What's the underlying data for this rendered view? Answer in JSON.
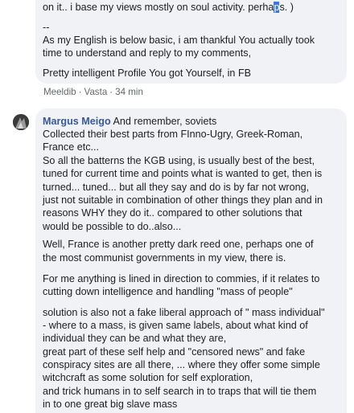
{
  "top_comment": {
    "line1_a": "on it.. i base my views mostly on soul activity. perha",
    "line1_hl": "p",
    "line1_b": "s. )",
    "line2": "--",
    "line3": "As my English is below basic, i am thankful You actually took",
    "line4": "time to understand and reply to my comments,",
    "line5": "Pretty intelligent Profile You got Yourself, in FB"
  },
  "actions": {
    "like": "Meeldib",
    "reply": "Vasta",
    "sep": "·",
    "time": "34 min"
  },
  "reply_comment": {
    "author": "Margus Meigo",
    "first_line": " And remember, soviets",
    "para1": [
      "Collected their best parts from FInno-Ugry, Greek-Roman,",
      "France etc...",
      "So all the batterns the KGB using, is usually best of the best,",
      "tuned for current time and points what is wanted to get, then is",
      "turned... tuned... but all they say and do is by far not wrong,",
      "just not suitable in combination of other things they plan and in",
      "reasons WHY they do it.. compared to other solutions that",
      "would be possible to do..also..."
    ],
    "para2": [
      "Well, France is another pretty dark reed one, perhaps one of",
      "the most communist governments in my view, there is."
    ],
    "para3": [
      "For me anything is lined in direction to commies, if it relates to",
      "cutting down intelligence and handling \"mass of people\""
    ],
    "para4": [
      "solution is also not a fake liberal approach of \" mass individual\"",
      "- where to a mass, is given same labels, about what kind of",
      "individual they can be and what they are,",
      "great part of these self help and \"censored news\" and fake",
      "conspiracy sites are all there, ... where they offer some simple",
      "witchcraft as some solution for self exploration,",
      "and trick humans in to self search in to traps that will tie them",
      "in to one great big slave mass"
    ]
  }
}
